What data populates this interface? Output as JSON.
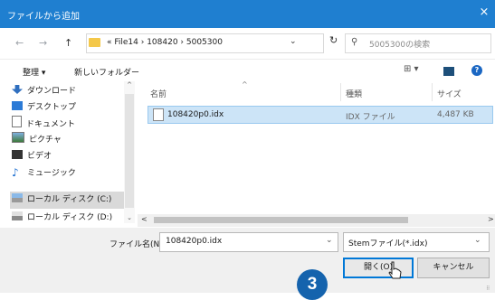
{
  "window": {
    "title": "ファイルから追加",
    "close": "×"
  },
  "nav": {
    "back": "←",
    "forward": "→",
    "up": "↑",
    "breadcrumb": "« File14 › 108420 › 5005300",
    "dropdown": "⌄",
    "refresh": "↻",
    "search_placeholder": "5005300の検索"
  },
  "toolbar": {
    "organize": "整理 ▾",
    "new_folder": "新しいフォルダー",
    "view": "⊞ ▾",
    "help": "?"
  },
  "navpane": {
    "items": [
      {
        "label": "ダウンロード",
        "icon": "download-icon"
      },
      {
        "label": "デスクトップ",
        "icon": "desktop-icon"
      },
      {
        "label": "ドキュメント",
        "icon": "document-icon"
      },
      {
        "label": "ピクチャ",
        "icon": "picture-icon"
      },
      {
        "label": "ビデオ",
        "icon": "video-icon"
      },
      {
        "label": "ミュージック",
        "icon": "music-icon"
      },
      {
        "label": "ローカル ディスク (C:)",
        "icon": "drive-icon",
        "selected": true
      },
      {
        "label": "ローカル ディスク (D:)",
        "icon": "drive-icon"
      }
    ],
    "scroll_up": "^",
    "scroll_down": "⌄"
  },
  "list": {
    "columns": {
      "name": "名前",
      "type": "種類",
      "size": "サイズ"
    },
    "sort_indicator": "^",
    "rows": [
      {
        "name": "108420p0.idx",
        "type": "IDX ファイル",
        "size": "4,487 KB"
      }
    ],
    "scroll_left": "<",
    "scroll_right": ">"
  },
  "bottom": {
    "filename_label": "ファイル名(N):",
    "filename_value": "108420p0.idx",
    "filter": "Stemファイル(*.idx)",
    "open": "開く(O)",
    "cancel": "キャンセル",
    "dropdown": "⌄"
  },
  "step_badge": "3",
  "colors": {
    "titlebar": "#1f7fd0",
    "selection": "#cce4f7",
    "badge": "#1563ad"
  }
}
